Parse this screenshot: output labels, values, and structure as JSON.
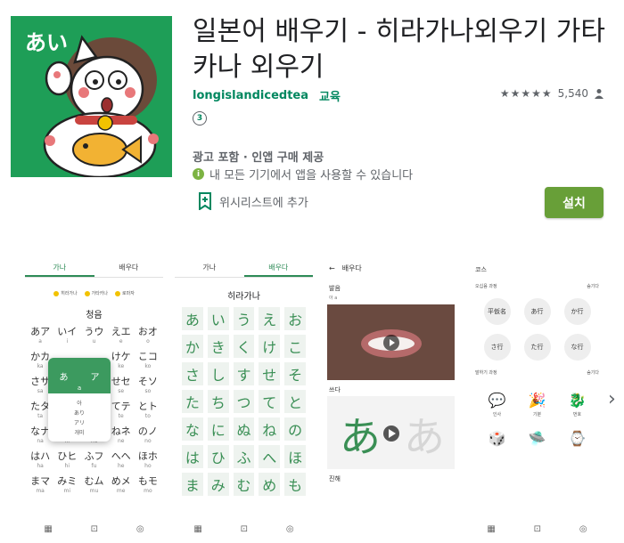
{
  "app": {
    "title": "일본어 배우기 - 히라가나외우기 가타카나 외우기",
    "developer": "longislandicedtea",
    "category": "교육",
    "rating_count": "5,540",
    "rating_stars": "★★★★★",
    "age_rating": "3",
    "ads_info": "광고 포함 · 인앱 구매 제공",
    "compat_text": "내 모든 기기에서 앱을 사용할 수 있습니다",
    "wishlist_label": "위시리스트에 추가",
    "install_label": "설치",
    "icon_text": "あい",
    "colors": {
      "accent": "#01875f",
      "install": "#689f38",
      "icon_bg": "#1e9e57"
    }
  },
  "screens": {
    "s1": {
      "tabs": [
        "가나",
        "배우다"
      ],
      "filters": [
        "히라가나",
        "가타카나",
        "로마자"
      ],
      "section": "청음",
      "cells": [
        {
          "k": "あア",
          "r": "a"
        },
        {
          "k": "いイ",
          "r": "i"
        },
        {
          "k": "うウ",
          "r": "u"
        },
        {
          "k": "えエ",
          "r": "e"
        },
        {
          "k": "おオ",
          "r": "o"
        },
        {
          "k": "かカ",
          "r": "ka"
        },
        {
          "k": "",
          "r": ""
        },
        {
          "k": "",
          "r": ""
        },
        {
          "k": "けケ",
          "r": "ke"
        },
        {
          "k": "こコ",
          "r": "ko"
        },
        {
          "k": "さサ",
          "r": "sa"
        },
        {
          "k": "",
          "r": ""
        },
        {
          "k": "",
          "r": ""
        },
        {
          "k": "せセ",
          "r": "se"
        },
        {
          "k": "そソ",
          "r": "so"
        },
        {
          "k": "たタ",
          "r": "ta"
        },
        {
          "k": "",
          "r": ""
        },
        {
          "k": "",
          "r": ""
        },
        {
          "k": "てテ",
          "r": "te"
        },
        {
          "k": "とト",
          "r": "to"
        },
        {
          "k": "なナ",
          "r": "na"
        },
        {
          "k": "にニ",
          "r": "ni"
        },
        {
          "k": "ぬヌ",
          "r": "nu"
        },
        {
          "k": "ねネ",
          "r": "ne"
        },
        {
          "k": "のノ",
          "r": "no"
        },
        {
          "k": "はハ",
          "r": "ha"
        },
        {
          "k": "ひヒ",
          "r": "hi"
        },
        {
          "k": "ふフ",
          "r": "fu"
        },
        {
          "k": "へヘ",
          "r": "he"
        },
        {
          "k": "ほホ",
          "r": "ho"
        },
        {
          "k": "まマ",
          "r": "ma"
        },
        {
          "k": "みミ",
          "r": "mi"
        },
        {
          "k": "むム",
          "r": "mu"
        },
        {
          "k": "めメ",
          "r": "me"
        },
        {
          "k": "もモ",
          "r": "mo"
        }
      ],
      "popup": {
        "hira": "あ",
        "kata": "ア",
        "roma": "a",
        "words": [
          "아",
          "あり",
          "アリ",
          "개미"
        ]
      }
    },
    "s2": {
      "tabs": [
        "가나",
        "배우다"
      ],
      "section": "히라가나",
      "cells": [
        "あ",
        "い",
        "う",
        "え",
        "お",
        "か",
        "き",
        "く",
        "け",
        "こ",
        "さ",
        "し",
        "す",
        "せ",
        "そ",
        "た",
        "ち",
        "つ",
        "て",
        "と",
        "な",
        "に",
        "ぬ",
        "ね",
        "の",
        "は",
        "ひ",
        "ふ",
        "へ",
        "ほ",
        "ま",
        "み",
        "む",
        "め",
        "も"
      ]
    },
    "s3": {
      "back": "배우다",
      "label1": "발음",
      "sub1": "아 a",
      "label2": "쓰다",
      "label3": "진해"
    },
    "s4": {
      "course_title": "코스",
      "row1_left": "오십음 과정",
      "row1_right": "숨기다",
      "circles": [
        "平仮名",
        "あ行",
        "か行",
        "さ行",
        "た行",
        "な行"
      ],
      "row2_left": "말하기 과정",
      "row2_right": "숨기다",
      "icons": [
        {
          "e": "💬",
          "l": "인사"
        },
        {
          "e": "🎉",
          "l": "기분"
        },
        {
          "e": "🐉",
          "l": "번호"
        },
        {
          "e": "🎲",
          "l": ""
        },
        {
          "e": "🛸",
          "l": ""
        },
        {
          "e": "⌚",
          "l": ""
        }
      ]
    }
  }
}
